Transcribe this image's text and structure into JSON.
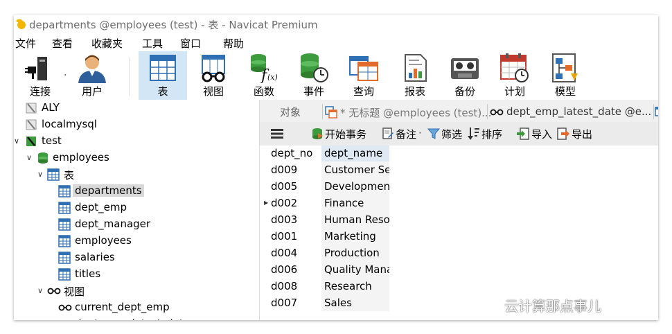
{
  "window": {
    "title": "departments @employees (test) - 表 - Navicat Premium"
  },
  "menu": {
    "items": [
      "文件",
      "查看",
      "收藏夹",
      "工具",
      "窗口",
      "帮助"
    ]
  },
  "toolbar": {
    "buttons": [
      {
        "label": "连接",
        "icon": "plug-icon"
      },
      {
        "label": "用户",
        "icon": "user-icon"
      },
      {
        "label": "表",
        "icon": "table-icon",
        "active": true
      },
      {
        "label": "视图",
        "icon": "view-icon"
      },
      {
        "label": "函数",
        "icon": "function-icon"
      },
      {
        "label": "事件",
        "icon": "event-icon"
      },
      {
        "label": "查询",
        "icon": "query-icon"
      },
      {
        "label": "报表",
        "icon": "report-icon"
      },
      {
        "label": "备份",
        "icon": "backup-icon"
      },
      {
        "label": "计划",
        "icon": "schedule-icon"
      },
      {
        "label": "模型",
        "icon": "model-icon"
      }
    ],
    "dropdown_dot": "·"
  },
  "sidebar": {
    "connections": [
      "ALY",
      "localmysql",
      "test"
    ],
    "database": "employees",
    "tables_group": "表",
    "tables": [
      "departments",
      "dept_emp",
      "dept_manager",
      "employees",
      "salaries",
      "titles"
    ],
    "selected_table": "departments",
    "views_group": "视图",
    "views": [
      "current_dept_emp",
      "dept_emp_latest_date"
    ]
  },
  "tabs": {
    "objects": "对象",
    "untitled": "* 无标题 @employees (test)...",
    "view_tab": "dept_emp_latest_date @e..."
  },
  "subtoolbar": {
    "begin_transaction": "开始事务",
    "memo": "备注",
    "memo_dot": "·",
    "filter": "筛选",
    "sort": "排序",
    "import": "导入",
    "export": "导出"
  },
  "grid": {
    "columns": [
      "dept_no",
      "dept_name"
    ],
    "rows": [
      [
        "d009",
        "Customer Service"
      ],
      [
        "d005",
        "Development"
      ],
      [
        "d002",
        "Finance"
      ],
      [
        "d003",
        "Human Resources"
      ],
      [
        "d001",
        "Marketing"
      ],
      [
        "d004",
        "Production"
      ],
      [
        "d006",
        "Quality Management"
      ],
      [
        "d008",
        "Research"
      ],
      [
        "d007",
        "Sales"
      ]
    ],
    "current_row_index": 2
  },
  "watermark": "云计算那点事儿",
  "colors": {
    "active_toolbar_bg": "#d3e6f6",
    "selection_bg": "#d9d9d9",
    "db_green": "#3c9b3c",
    "table_blue": "#2f6fb3"
  }
}
